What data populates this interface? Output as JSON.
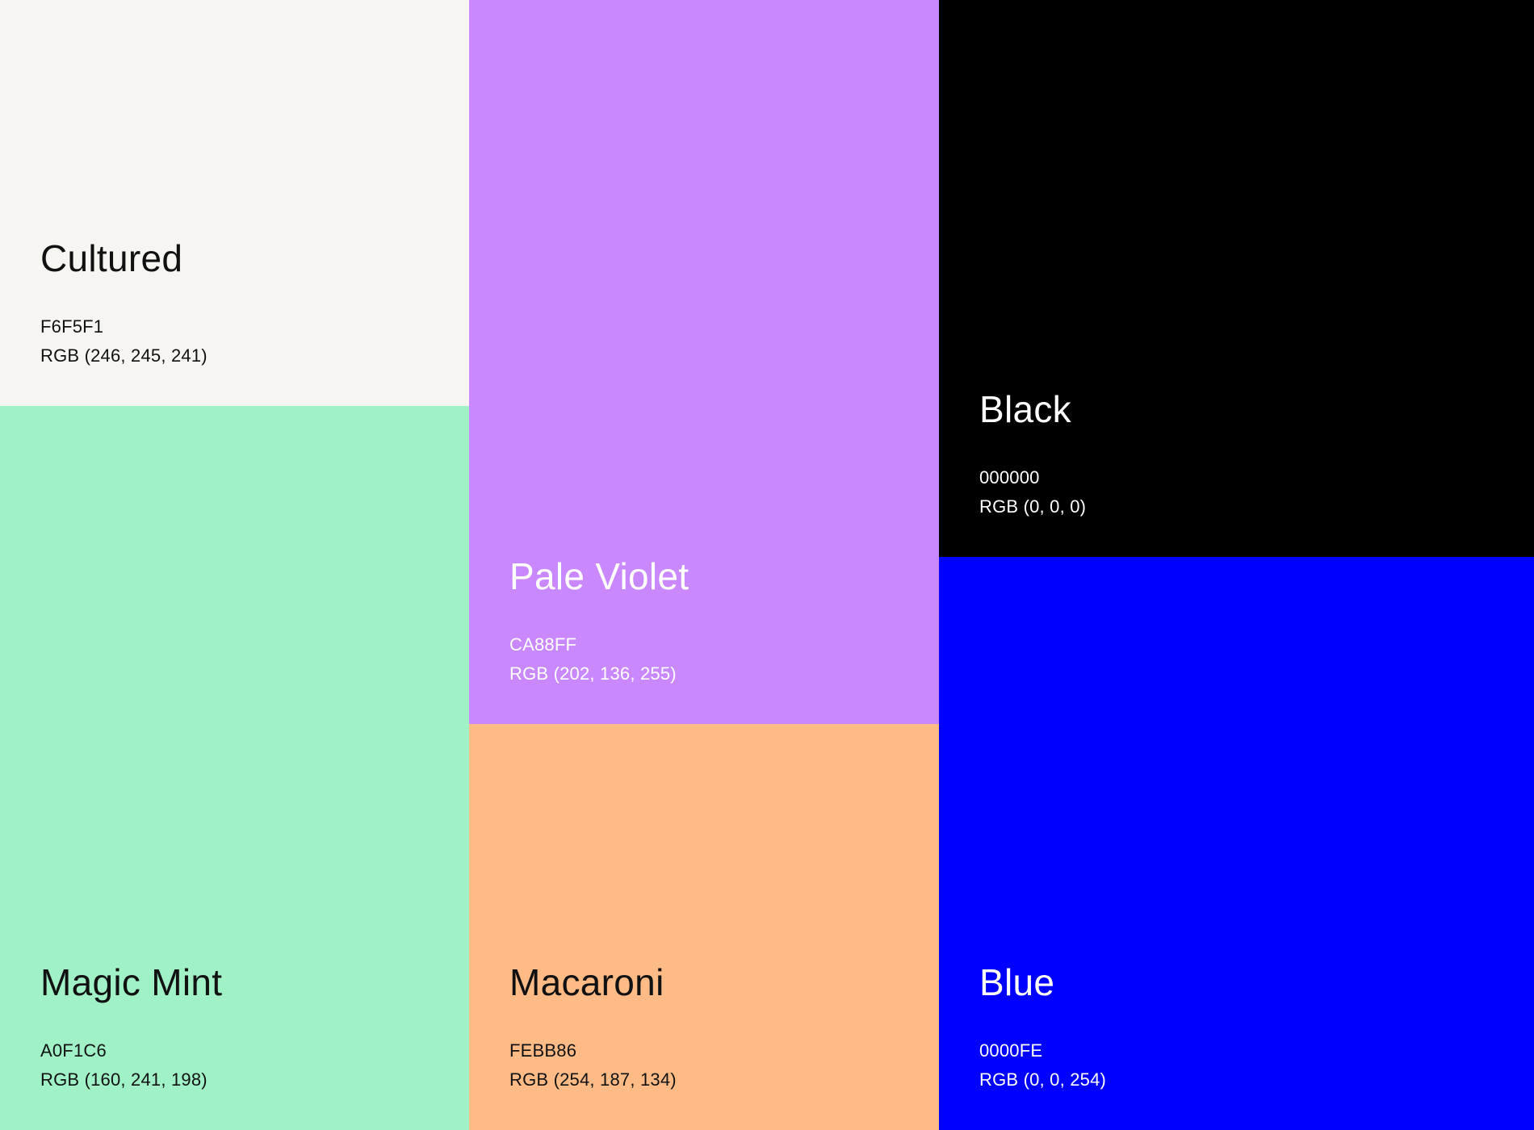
{
  "swatches": [
    {
      "id": "cultured",
      "name": "Cultured",
      "hex": "F6F5F1",
      "rgb": "RGB (246, 245, 241)",
      "color": "#F6F5F1",
      "text_color": "#111111"
    },
    {
      "id": "mint",
      "name": "Magic Mint",
      "hex": "A0F1C6",
      "rgb": "RGB (160, 241, 198)",
      "color": "#A0F1C6",
      "text_color": "#111111"
    },
    {
      "id": "violet",
      "name": "Pale Violet",
      "hex": "CA88FF",
      "rgb": "RGB (202, 136, 255)",
      "color": "#CA88FF",
      "text_color": "#FFFFFF"
    },
    {
      "id": "macaroni",
      "name": "Macaroni",
      "hex": "FEBB86",
      "rgb": "RGB (254, 187, 134)",
      "color": "#FEBB86",
      "text_color": "#111111"
    },
    {
      "id": "black",
      "name": "Black",
      "hex": "000000",
      "rgb": "RGB (0, 0, 0)",
      "color": "#000000",
      "text_color": "#FFFFFF"
    },
    {
      "id": "blue",
      "name": "Blue",
      "hex": "0000FE",
      "rgb": "RGB (0, 0, 254)",
      "color": "#0000FE",
      "text_color": "#FFFFFF"
    }
  ]
}
